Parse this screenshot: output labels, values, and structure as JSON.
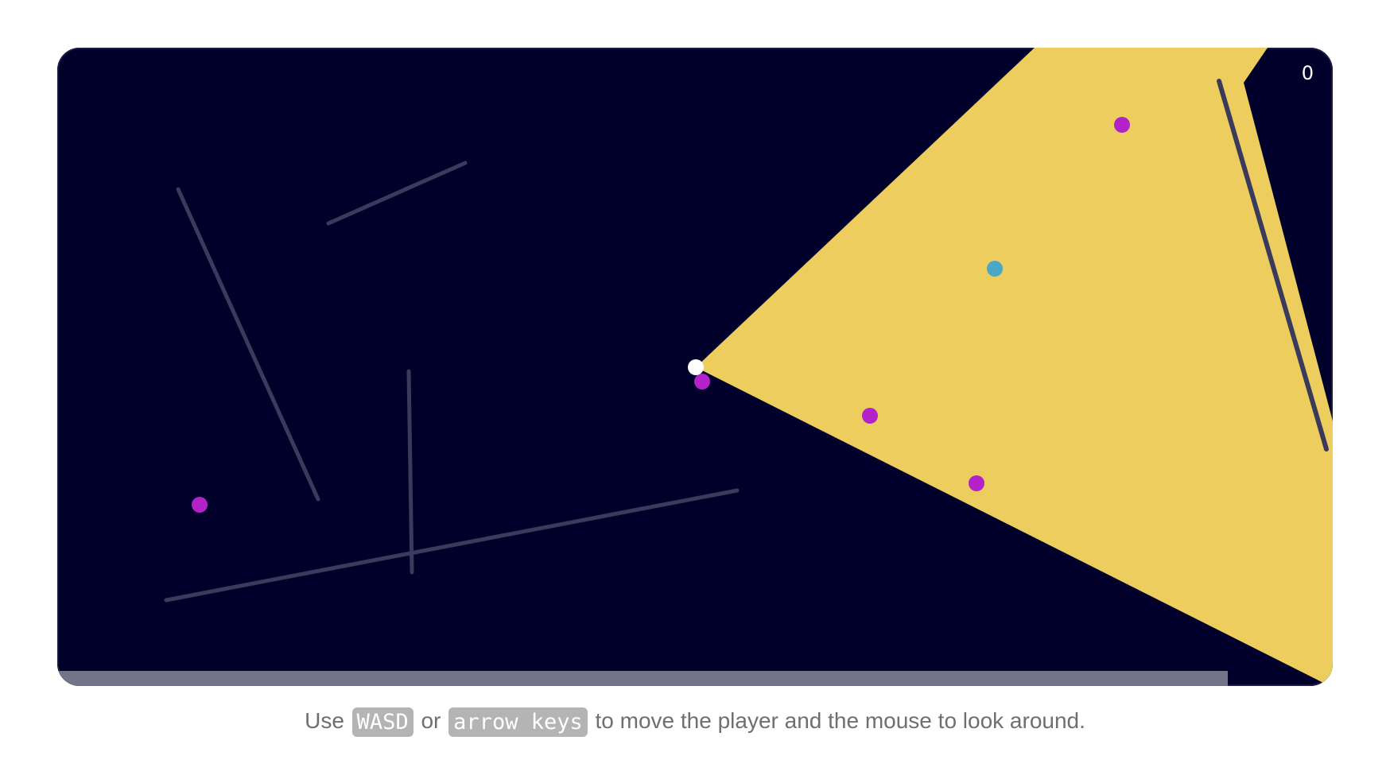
{
  "game": {
    "score": "0",
    "level_progress": 0.918,
    "colors": {
      "background": "#00002a",
      "light_cone": "#edcd5e",
      "wall": "#3a3a5c",
      "player": "#ffffff",
      "enemy": "#b222c8",
      "goal": "#4aa8c7",
      "progress": "#747488"
    }
  },
  "instructions": {
    "prefix": "Use",
    "key1": "WASD",
    "mid": "or",
    "key2": "arrow keys",
    "suffix": "to move the player and the mouse to look around."
  }
}
